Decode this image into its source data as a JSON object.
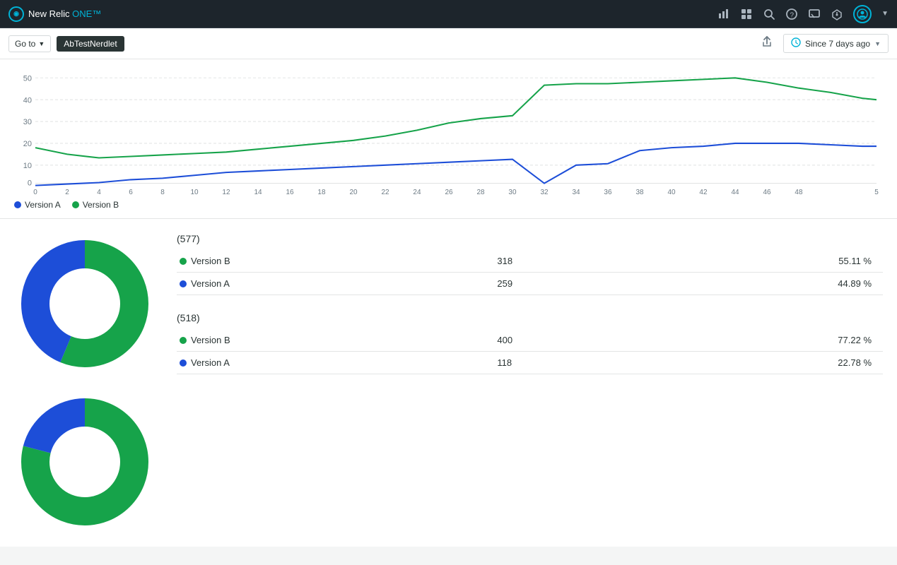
{
  "app": {
    "title": "New Relic ONE™",
    "logo_text": "New Relic",
    "logo_accent": "ONE™"
  },
  "toolbar": {
    "goto_label": "Go to",
    "nerdlet_label": "AbTestNerdlet",
    "share_icon": "⬆",
    "time_picker_label": "Since 7 days ago",
    "time_picker_icon": "🕐"
  },
  "chart": {
    "y_labels": [
      "50",
      "40",
      "30",
      "20",
      "10",
      "0"
    ],
    "x_labels": [
      "0",
      "2",
      "4",
      "6",
      "8",
      "10",
      "12",
      "14",
      "16",
      "18",
      "20",
      "22",
      "24",
      "26",
      "28",
      "30",
      "32",
      "34",
      "36",
      "38",
      "40",
      "42",
      "44",
      "46",
      "48",
      "5"
    ],
    "version_a_color": "#1d4ed8",
    "version_b_color": "#16a34a",
    "version_a_label": "Version A",
    "version_b_label": "Version B"
  },
  "legend": {
    "items": [
      {
        "label": "Version A",
        "color": "#1d4ed8"
      },
      {
        "label": "Version B",
        "color": "#16a34a"
      }
    ]
  },
  "chart1": {
    "total": "(577)",
    "rows": [
      {
        "label": "Version B",
        "color": "#16a34a",
        "count": "318",
        "percent": "55.11 %"
      },
      {
        "label": "Version A",
        "color": "#1d4ed8",
        "count": "259",
        "percent": "44.89 %"
      }
    ],
    "donut": {
      "version_b_pct": 55.11,
      "version_a_pct": 44.89
    }
  },
  "chart2": {
    "total": "(518)",
    "rows": [
      {
        "label": "Version B",
        "color": "#16a34a",
        "count": "400",
        "percent": "77.22 %"
      },
      {
        "label": "Version A",
        "color": "#1d4ed8",
        "count": "118",
        "percent": "22.78 %"
      }
    ],
    "donut": {
      "version_b_pct": 77.22,
      "version_a_pct": 22.78
    }
  },
  "nav_icons": {
    "chart_icon": "▦",
    "grid_icon": "⊞",
    "search_icon": "🔍",
    "help_icon": "?",
    "chat_icon": "💬",
    "bell_icon": "🔔"
  }
}
